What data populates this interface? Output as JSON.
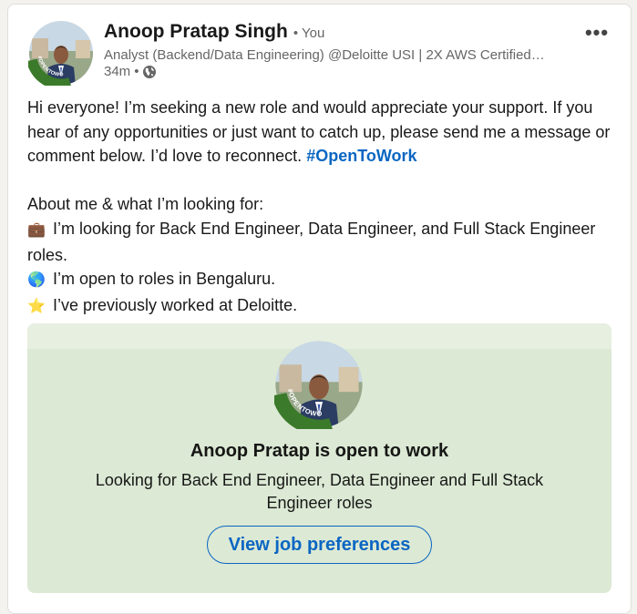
{
  "post": {
    "author_name": "Anoop Pratap Singh",
    "degree": "• You",
    "headline": "Analyst (Backend/Data Engineering) @Deloitte USI | 2X AWS Certified…",
    "time": "34m",
    "meta_separator": "•",
    "visibility_icon": "globe-icon",
    "more_icon": "more-horizontal-icon",
    "more_label": "•••",
    "body": {
      "intro": "Hi everyone! I’m seeking a new role and would appreciate your support. If you hear of any opportunities or just want to catch up, please send me a message or comment below. I’d love to reconnect.",
      "hashtag": "#OpenToWork",
      "about_heading": "About me & what I’m looking for:",
      "items": [
        {
          "icon": "briefcase-icon",
          "emoji": "💼",
          "text": "I’m looking for Back End Engineer, Data Engineer, and Full Stack Engineer roles."
        },
        {
          "icon": "globe-icon",
          "emoji": "🌎",
          "text": "I’m open to roles in Bengaluru."
        },
        {
          "icon": "star-icon",
          "emoji": "⭐",
          "text": "I’ve previously worked at Deloitte."
        }
      ]
    }
  },
  "open_to_work": {
    "badge_text": "#OPENTOWORK",
    "title": "Anoop Pratap is open to work",
    "subtitle": "Looking for Back End Engineer, Data Engineer and Full Stack Engineer roles",
    "button_label": "View job preferences"
  },
  "colors": {
    "link": "#0a66c2",
    "otw_green": "#3b7a2a",
    "card_bg": "#dce9d5"
  }
}
